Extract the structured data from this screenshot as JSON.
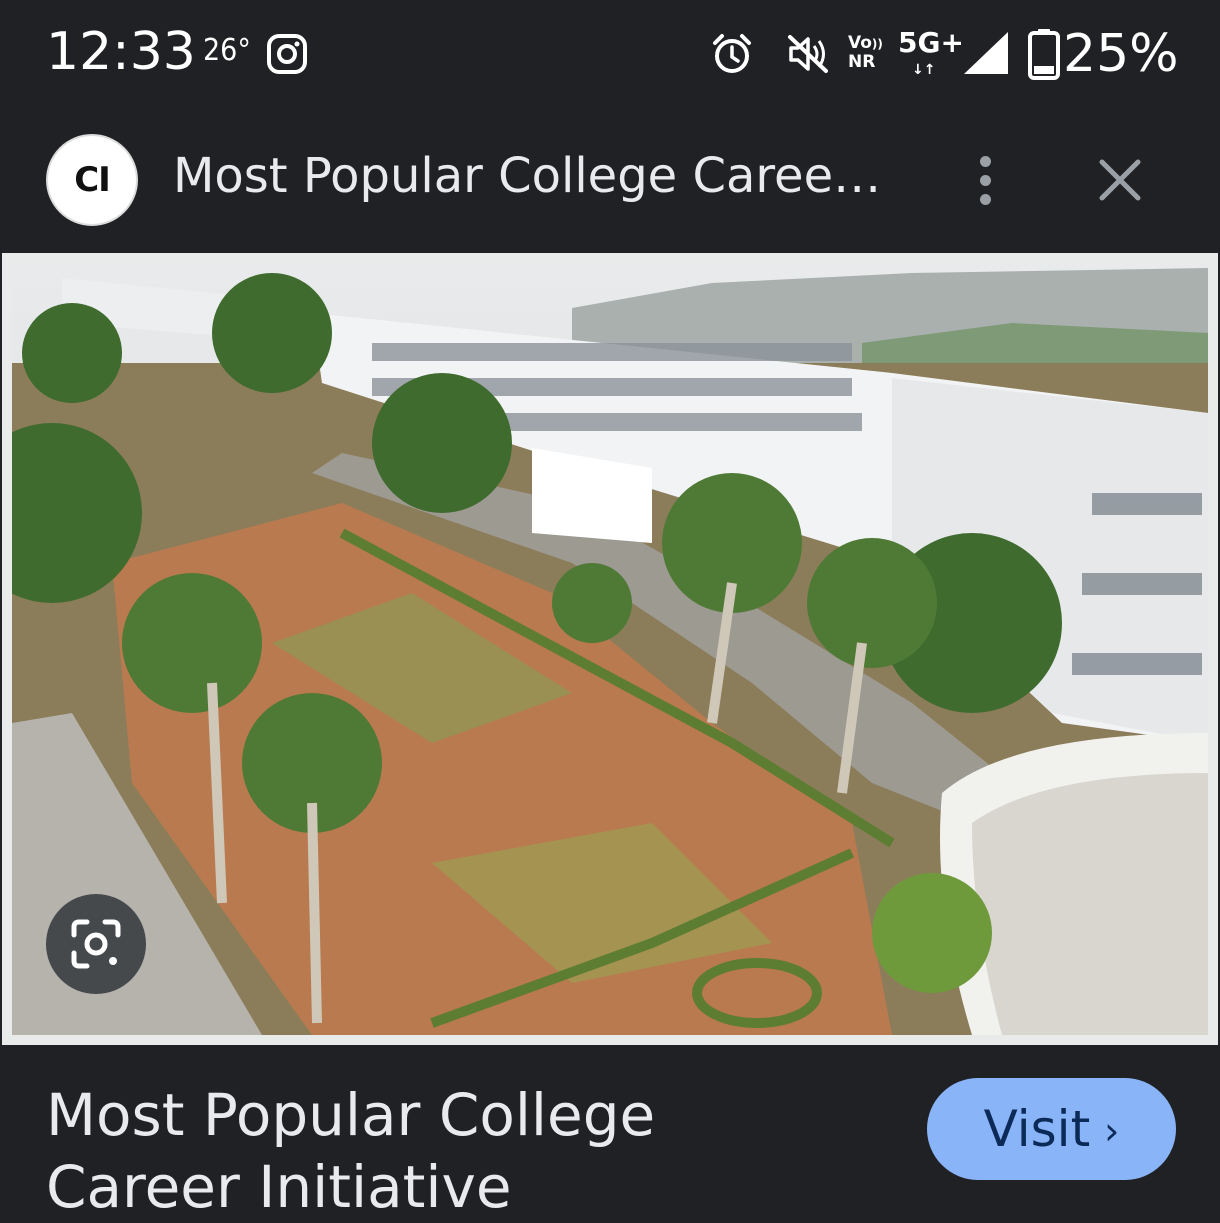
{
  "status_bar": {
    "time": "12:33",
    "temperature": "26°",
    "network_volte": "Vo\nNR",
    "network_type": "5G+",
    "data_arrows": "↓↑",
    "battery_percent": "25%",
    "icons": [
      "instagram-icon",
      "alarm-icon",
      "mute-icon",
      "signal-icon",
      "battery-icon"
    ]
  },
  "header": {
    "logo_text": "CI",
    "title": "Most Popular College Career Initiative",
    "more_icon": "more-vert-icon",
    "close_icon": "close-icon"
  },
  "image": {
    "lens_icon": "google-lens-icon"
  },
  "footer": {
    "title": "Most Popular College Career Initiative",
    "visit_label": "Visit",
    "visit_chevron": "›"
  },
  "colors": {
    "background": "#202124",
    "text": "#e8eaed",
    "visit_button": "#8ab4f8",
    "visit_text": "#0c2a57"
  }
}
